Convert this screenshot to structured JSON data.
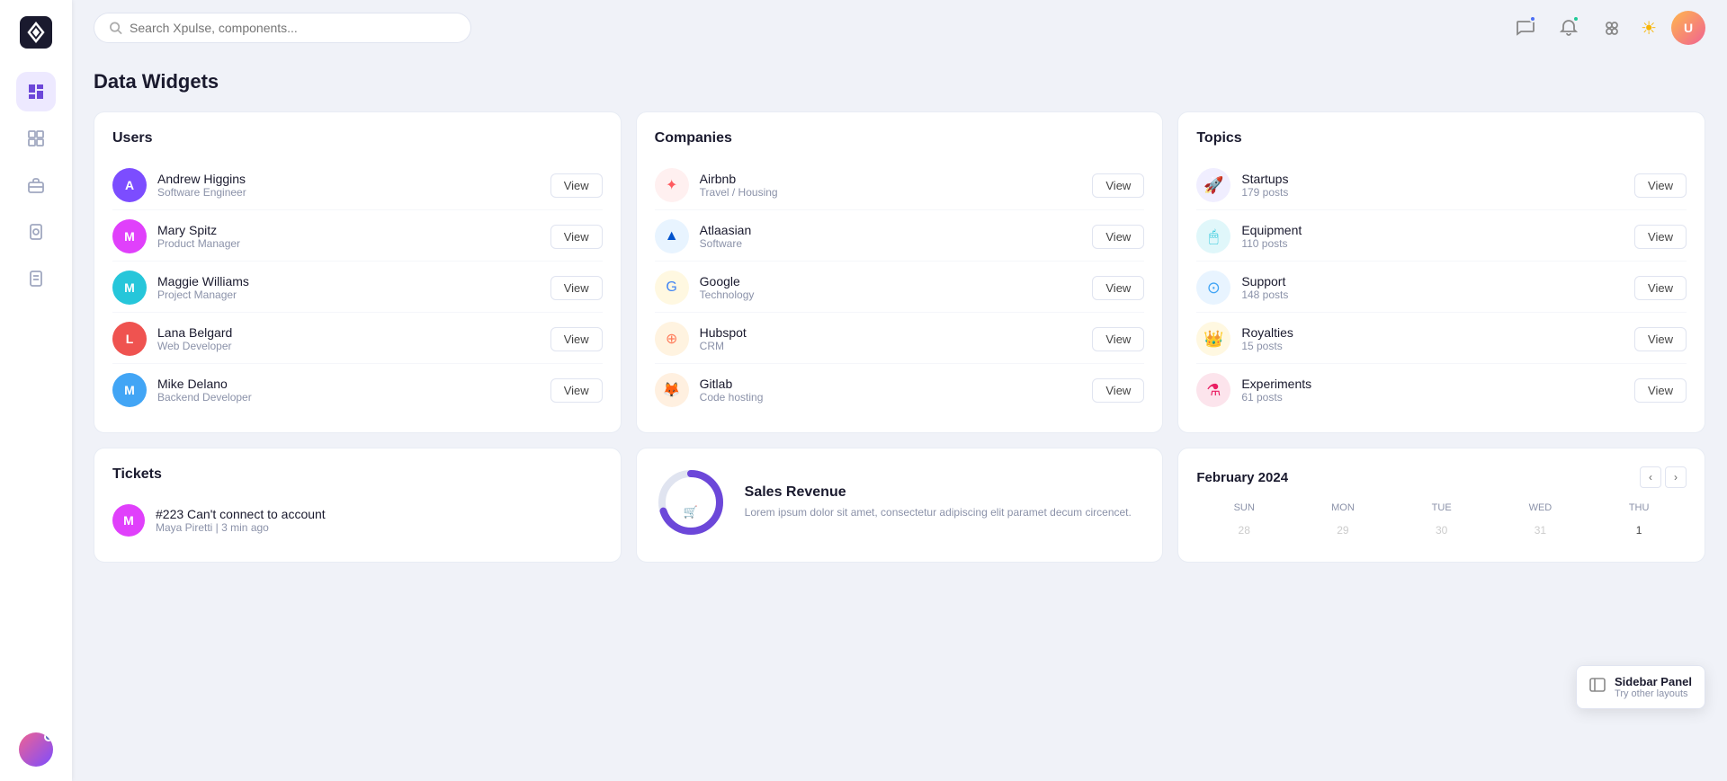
{
  "app": {
    "name": "Xpulse",
    "search_placeholder": "Search Xpulse, components..."
  },
  "page": {
    "title": "Data Widgets"
  },
  "sidebar": {
    "nav_items": [
      {
        "id": "dashboard",
        "icon": "dashboard",
        "active": true
      },
      {
        "id": "grid",
        "icon": "grid"
      },
      {
        "id": "briefcase",
        "icon": "briefcase"
      },
      {
        "id": "document",
        "icon": "document"
      },
      {
        "id": "clipboard",
        "icon": "clipboard"
      }
    ]
  },
  "users_widget": {
    "title": "Users",
    "view_label": "View",
    "users": [
      {
        "name": "Andrew Higgins",
        "role": "Software Engineer",
        "color": "#7c4dff"
      },
      {
        "name": "Mary Spitz",
        "role": "Product Manager",
        "color": "#e040fb"
      },
      {
        "name": "Maggie Williams",
        "role": "Project Manager",
        "color": "#26c6da"
      },
      {
        "name": "Lana Belgard",
        "role": "Web Developer",
        "color": "#ef5350"
      },
      {
        "name": "Mike Delano",
        "role": "Backend Developer",
        "color": "#42a5f5"
      }
    ]
  },
  "companies_widget": {
    "title": "Companies",
    "view_label": "View",
    "companies": [
      {
        "name": "Airbnb",
        "sub": "Travel / Housing",
        "bg": "#fff0f0",
        "color": "#ff5a5f",
        "icon": "✦"
      },
      {
        "name": "Atlaasian",
        "sub": "Software",
        "bg": "#e8f4ff",
        "color": "#0052cc",
        "icon": "▲"
      },
      {
        "name": "Google",
        "sub": "Technology",
        "bg": "#fff8e1",
        "color": "#4285f4",
        "icon": "G"
      },
      {
        "name": "Hubspot",
        "sub": "CRM",
        "bg": "#fff3e0",
        "color": "#ff7a59",
        "icon": "⊕"
      },
      {
        "name": "Gitlab",
        "sub": "Code hosting",
        "bg": "#fff0e0",
        "color": "#e24329",
        "icon": "🦊"
      }
    ]
  },
  "topics_widget": {
    "title": "Topics",
    "view_label": "View",
    "topics": [
      {
        "name": "Startups",
        "sub": "179 posts",
        "bg": "#f0eeff",
        "color": "#7c4dff",
        "icon": "🚀"
      },
      {
        "name": "Equipment",
        "sub": "110 posts",
        "bg": "#e0f7fa",
        "color": "#26c6da",
        "icon": "🖱"
      },
      {
        "name": "Support",
        "sub": "148 posts",
        "bg": "#e8f4ff",
        "color": "#42a5f5",
        "icon": "⊙"
      },
      {
        "name": "Royalties",
        "sub": "15 posts",
        "bg": "#fff8e1",
        "color": "#ffb300",
        "icon": "👑"
      },
      {
        "name": "Experiments",
        "sub": "61 posts",
        "bg": "#fce4ec",
        "color": "#e91e63",
        "icon": "⚗"
      }
    ]
  },
  "tickets_widget": {
    "title": "Tickets",
    "tickets": [
      {
        "id": "#223",
        "title": "Can't connect to account",
        "author": "Maya Piretti",
        "time": "3 min ago",
        "color": "#e040fb"
      }
    ]
  },
  "sales_widget": {
    "title": "Sales Revenue",
    "description": "Lorem ipsum dolor sit amet, consectetur adipiscing elit paramet decum circencet.",
    "donut_value": 70,
    "donut_color": "#6c47d9",
    "donut_track": "#e0e4f0"
  },
  "calendar_widget": {
    "title": "February 2024",
    "prev_label": "‹",
    "next_label": "›",
    "day_headers": [
      "SUN",
      "MON",
      "TUE",
      "WED",
      "THU"
    ],
    "days": [
      {
        "label": "28",
        "prev": true
      },
      {
        "label": "29",
        "prev": true
      },
      {
        "label": "30",
        "prev": true
      },
      {
        "label": "31",
        "prev": true
      },
      {
        "label": "1"
      }
    ]
  },
  "sidebar_panel": {
    "label": "Sidebar Panel",
    "sub": "Try other layouts"
  }
}
